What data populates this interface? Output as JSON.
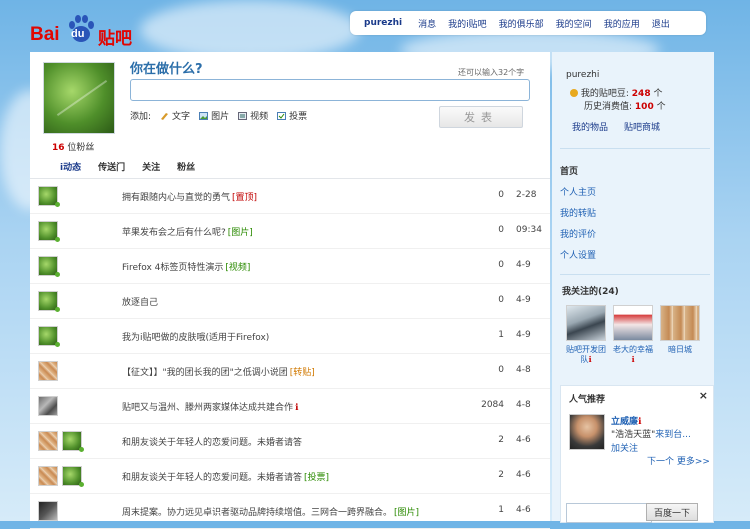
{
  "header": {
    "logo": {
      "bai": "Bai",
      "du": "du",
      "tieba": "贴吧"
    },
    "nav": {
      "username": "purezhi",
      "items": [
        "消息",
        "我的i贴吧",
        "我的俱乐部",
        "我的空间",
        "我的应用",
        "退出"
      ]
    }
  },
  "profile": {
    "fans_count": "16",
    "fans_label": "位粉丝",
    "prompt": "你在做什么?",
    "remaining": "还可以输入32个字",
    "status_value": "",
    "add_label": "添加:",
    "add_options": [
      {
        "icon": "text-icon",
        "label": "文字"
      },
      {
        "icon": "image-icon",
        "label": "图片"
      },
      {
        "icon": "video-icon",
        "label": "视频"
      },
      {
        "icon": "vote-icon",
        "label": "投票"
      }
    ],
    "post_button": "发表"
  },
  "tabs": [
    "i动态",
    "传送门",
    "关注",
    "粉丝"
  ],
  "feed": [
    {
      "title": "拥有跟随内心与直觉的勇气",
      "tag": "[置顶]",
      "tag_color": "#c00000",
      "count": "0",
      "date": "2-28",
      "thumb": "green",
      "thumb2": ""
    },
    {
      "title": "苹果发布会之后有什么呢?",
      "tag": "[图片]",
      "tag_color": "#2a8a00",
      "count": "0",
      "date": "09:34",
      "thumb": "green",
      "thumb2": ""
    },
    {
      "title": "Firefox 4标签页特性演示",
      "tag": "[视频]",
      "tag_color": "#2a8a00",
      "count": "0",
      "date": "4-9",
      "thumb": "green",
      "thumb2": ""
    },
    {
      "title": "放逐自己",
      "tag": "",
      "tag_color": "",
      "count": "0",
      "date": "4-9",
      "thumb": "green",
      "thumb2": ""
    },
    {
      "title": "我为i贴吧做的皮肤哦(适用于Firefox)",
      "tag": "",
      "tag_color": "",
      "count": "1",
      "date": "4-9",
      "thumb": "green",
      "thumb2": ""
    },
    {
      "title": "【征文】】\"我的团长我的团\"之低调小说团",
      "tag": "[转贴]",
      "tag_color": "#d07800",
      "count": "0",
      "date": "4-8",
      "thumb": "orange",
      "thumb2": ""
    },
    {
      "title": "贴吧又与温州、滕州两家媒体达成共建合作",
      "tag": "ℹ",
      "tag_color": "#c00000",
      "count": "2084",
      "date": "4-8",
      "thumb": "photo",
      "thumb2": ""
    },
    {
      "title": "和朋友谈关于年轻人的恋爱问题。未婚者请答",
      "tag": "",
      "tag_color": "",
      "count": "2",
      "date": "4-6",
      "thumb": "orange",
      "thumb2": "green"
    },
    {
      "title": "和朋友谈关于年轻人的恋爱问题。未婚者请答",
      "tag": "[投票]",
      "tag_color": "#2a8a00",
      "count": "2",
      "date": "4-6",
      "thumb": "orange",
      "thumb2": "green"
    },
    {
      "title": "周末提案。协力远见卓识者驱动品牌持续增值。三网合一跨界融合。",
      "tag": "[图片]",
      "tag_color": "#2a8a00",
      "count": "1",
      "date": "4-6",
      "thumb": "dark",
      "thumb2": ""
    }
  ],
  "sidebar": {
    "username": "purezhi",
    "beans_label": "我的贴吧豆:",
    "beans_value": "248",
    "unit": "个",
    "history_label": "历史消费值:",
    "history_value": "100",
    "links": [
      "我的物品",
      "贴吧商城"
    ],
    "nav": [
      "首页",
      "个人主页",
      "我的转贴",
      "我的评价",
      "个人设置"
    ],
    "following_title": "我关注的(24)",
    "following": [
      {
        "label": "贴吧开发团队",
        "badge": "ℹ",
        "pic": "laptop"
      },
      {
        "label": "老大的幸福",
        "badge": "ℹ",
        "pic": "poster"
      },
      {
        "label": "暗日城",
        "badge": "",
        "pic": "cats"
      }
    ],
    "popular_title": "人气推荐",
    "popular_close": "×",
    "popular": {
      "name": "立威廉",
      "badge": "ℹ",
      "desc_from": "\"浩浩天蓝\"",
      "desc_rest": "来到台...",
      "add": "加关注",
      "next": "下一个",
      "more": "更多>>"
    },
    "search_placeholder": "",
    "search_button": "百度一下"
  }
}
